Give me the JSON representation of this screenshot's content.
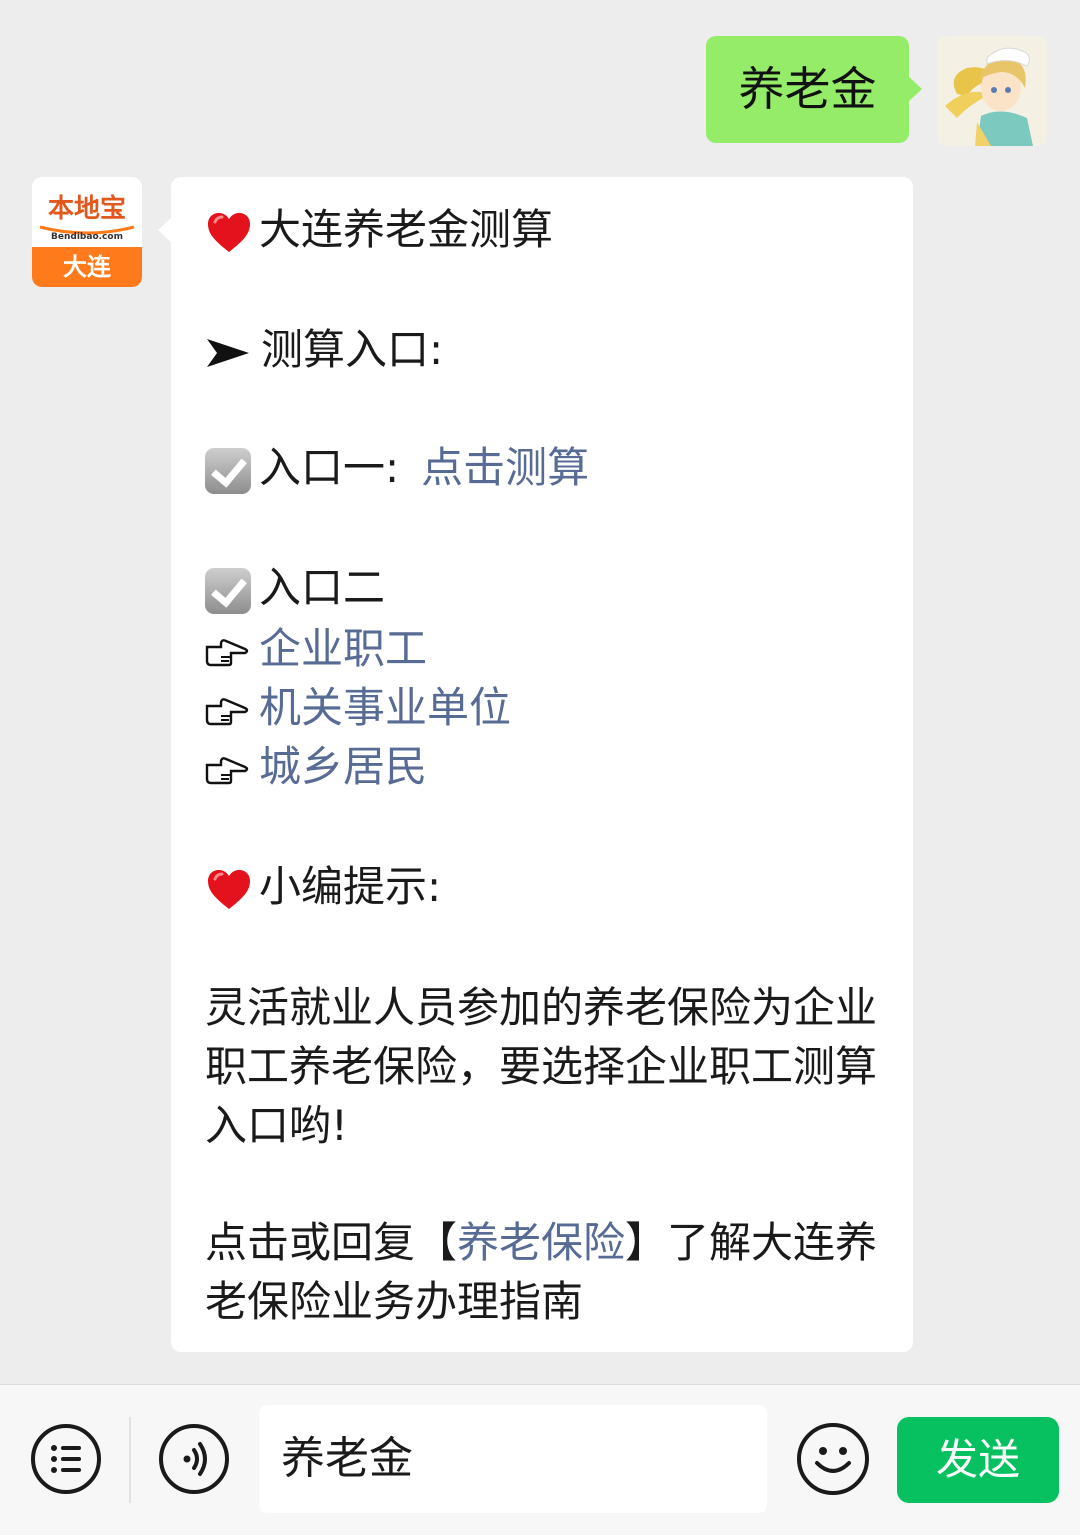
{
  "chat": {
    "user_message": "养老金",
    "bot": {
      "logo": {
        "brand": "本地宝",
        "domain": "Bendibao.com",
        "city": "大连"
      },
      "lines": {
        "title": "大连养老金测算",
        "entry_heading": "测算入口:",
        "entry_one_label": "入口一:",
        "entry_one_link": "点击测算",
        "entry_two_label": "入口二",
        "link_enterprise": "企业职工",
        "link_institution": "机关事业单位",
        "link_residents": "城乡居民",
        "tip_heading": "小编提示:",
        "tip_text": "灵活就业人员参加的养老保险为企业职工养老保险，要选择企业职工测算入口哟!",
        "reply_prefix": "点击或回复【",
        "reply_link": "养老保险",
        "reply_suffix": "】了解大连养老保险业务办理指南"
      }
    }
  },
  "input_bar": {
    "input_value": "养老金",
    "send_label": "发送"
  },
  "icons": {
    "heart": "red-heart-icon",
    "arrow": "arrow-right-icon",
    "check": "checkbox-checked-icon",
    "hand": "pointing-hand-icon",
    "menu": "menu-list-icon",
    "voice": "voice-icon",
    "emoji": "emoji-icon"
  },
  "colors": {
    "user_bubble": "#95ec69",
    "link": "#576b95",
    "send_button": "#07c160",
    "logo_orange": "#ff7a1a"
  }
}
